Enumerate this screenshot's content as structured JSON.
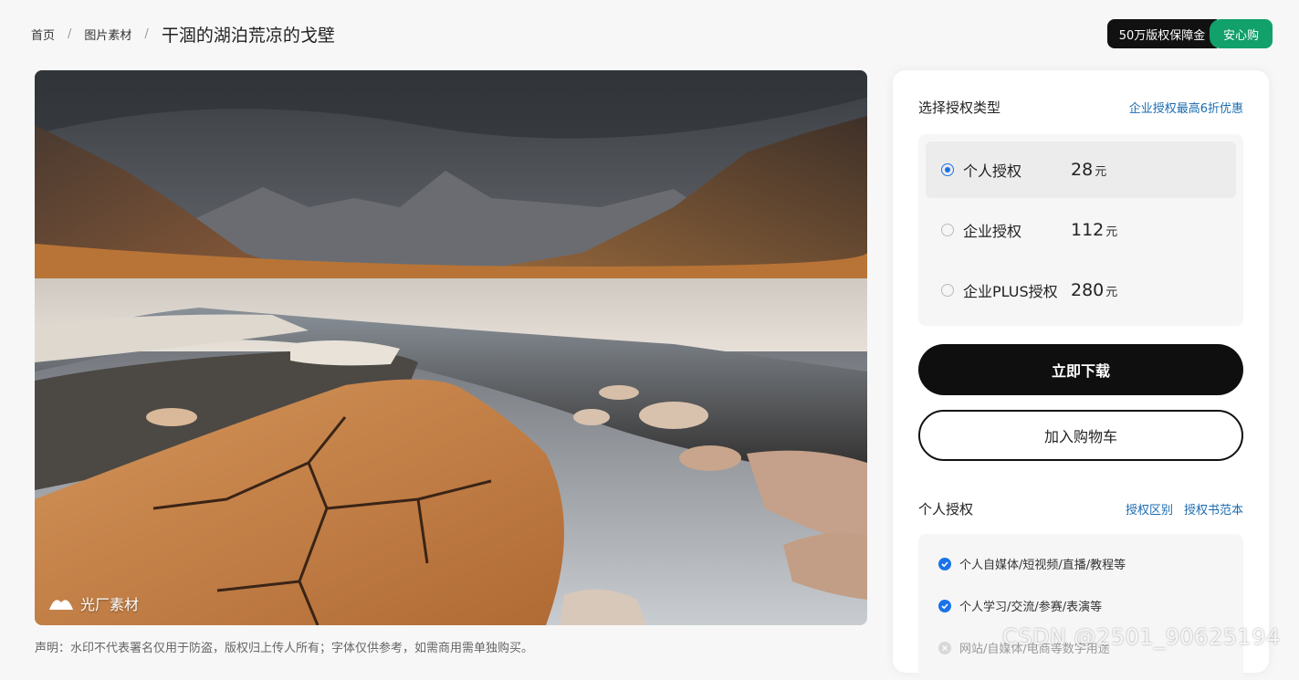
{
  "breadcrumb": {
    "home": "首页",
    "category": "图片素材",
    "current": "干涸的湖泊荒凉的戈壁",
    "separator": "/"
  },
  "promo": {
    "left": "50万版权保障金",
    "right": "安心购"
  },
  "photo": {
    "watermark": "光厂素材",
    "disclaimer": "声明：水印不代表署名仅用于防盗，版权归上传人所有；字体仅供参考，如需商用需单独购买。"
  },
  "license": {
    "title": "选择授权类型",
    "promo_link": "企业授权最高6折优惠",
    "unit": "元",
    "options": [
      {
        "label": "个人授权",
        "price": "28",
        "selected": true
      },
      {
        "label": "企业授权",
        "price": "112",
        "selected": false
      },
      {
        "label": "企业PLUS授权",
        "price": "280",
        "selected": false
      }
    ]
  },
  "actions": {
    "download": "立即下载",
    "add_cart": "加入购物车"
  },
  "scope": {
    "title": "个人授权",
    "link_diff": "授权区别",
    "link_sample": "授权书范本",
    "items": [
      {
        "text": "个人自媒体/短视频/直播/教程等",
        "allowed": true
      },
      {
        "text": "个人学习/交流/参赛/表演等",
        "allowed": true
      },
      {
        "text": "网站/自媒体/电商等数字用途",
        "allowed": false
      }
    ]
  },
  "overlay_watermark": "CSDN @2501_90625194",
  "colors": {
    "accent_blue": "#1a73e8",
    "link_blue": "#1a6bb0",
    "promo_green": "#12a06b",
    "button_black": "#0f0f0f"
  }
}
